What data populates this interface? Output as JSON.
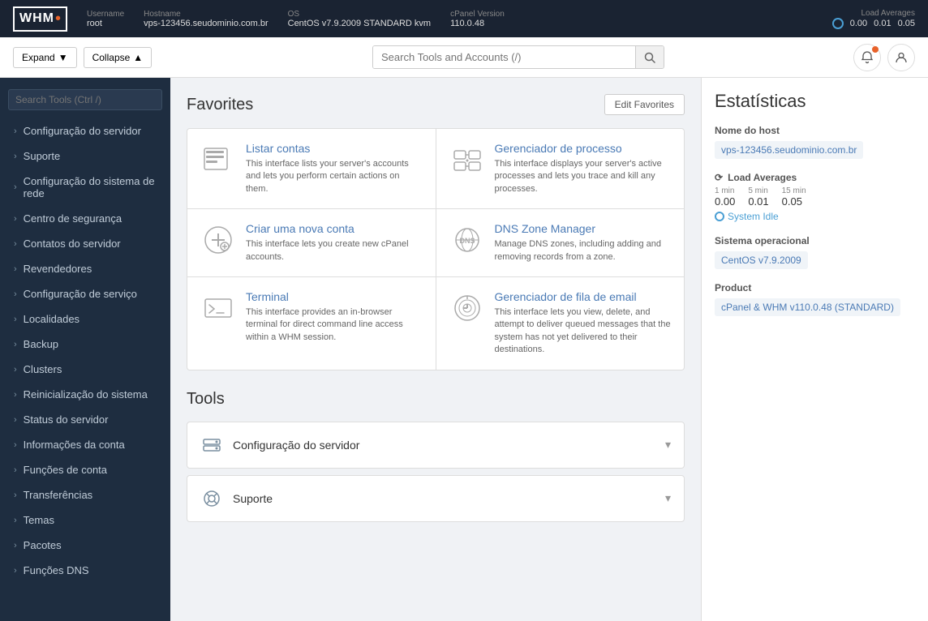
{
  "topbar": {
    "username_label": "Username",
    "username_value": "root",
    "hostname_label": "Hostname",
    "hostname_value": "vps-123456.seudominio.com.br",
    "os_label": "OS",
    "os_value": "CentOS v7.9.2009 STANDARD kvm",
    "cpanel_label": "cPanel Version",
    "cpanel_value": "110.0.48",
    "load_label": "Load Averages",
    "load_1min": "0.00",
    "load_5min": "0.01",
    "load_15min": "0.05"
  },
  "secondbar": {
    "expand_label": "Expand",
    "collapse_label": "Collapse",
    "search_placeholder": "Search Tools and Accounts (/)"
  },
  "sidebar": {
    "search_placeholder": "Search Tools (Ctrl /)",
    "items": [
      {
        "label": "Configuração do servidor"
      },
      {
        "label": "Suporte"
      },
      {
        "label": "Configuração do sistema de rede"
      },
      {
        "label": "Centro de segurança"
      },
      {
        "label": "Contatos do servidor"
      },
      {
        "label": "Revendedores"
      },
      {
        "label": "Configuração de serviço"
      },
      {
        "label": "Localidades"
      },
      {
        "label": "Backup"
      },
      {
        "label": "Clusters"
      },
      {
        "label": "Reinicialização do sistema"
      },
      {
        "label": "Status do servidor"
      },
      {
        "label": "Informações da conta"
      },
      {
        "label": "Funções de conta"
      },
      {
        "label": "Transferências"
      },
      {
        "label": "Temas"
      },
      {
        "label": "Pacotes"
      },
      {
        "label": "Funções DNS"
      }
    ]
  },
  "favorites": {
    "title": "Favorites",
    "edit_button": "Edit Favorites",
    "cards": [
      {
        "title": "Listar contas",
        "description": "This interface lists your server's accounts and lets you perform certain actions on them."
      },
      {
        "title": "Gerenciador de processo",
        "description": "This interface displays your server's active processes and lets you trace and kill any processes."
      },
      {
        "title": "Criar uma nova conta",
        "description": "This interface lets you create new cPanel accounts."
      },
      {
        "title": "DNS Zone Manager",
        "description": "Manage DNS zones, including adding and removing records from a zone."
      },
      {
        "title": "Terminal",
        "description": "This interface provides an in-browser terminal for direct command line access within a WHM session."
      },
      {
        "title": "Gerenciador de fila de email",
        "description": "This interface lets you view, delete, and attempt to deliver queued messages that the system has not yet delivered to their destinations."
      }
    ]
  },
  "tools": {
    "title": "Tools",
    "rows": [
      {
        "label": "Configuração do servidor"
      },
      {
        "label": "Suporte"
      }
    ]
  },
  "stats": {
    "title": "Estatísticas",
    "hostname_label": "Nome do host",
    "hostname_value": "vps-123456.seudominio.com.br",
    "load_avg_label": "Load Averages",
    "load_1min_label": "1 min",
    "load_5min_label": "5 min",
    "load_15min_label": "15 min",
    "load_1min_val": "0.00",
    "load_5min_val": "0.01",
    "load_15min_val": "0.05",
    "system_idle": "System Idle",
    "os_label": "Sistema operacional",
    "os_value": "CentOS v7.9.2009",
    "product_label": "Product",
    "product_value": "cPanel & WHM v110.0.48 (STANDARD)"
  }
}
